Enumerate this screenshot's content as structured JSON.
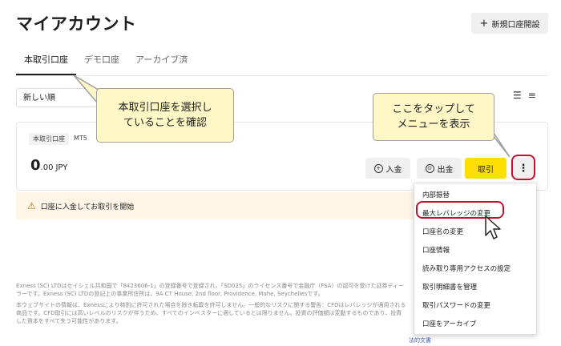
{
  "header": {
    "title": "マイアカウント",
    "new_account_label": "新規口座開設"
  },
  "tabs": [
    {
      "label": "本取引口座",
      "active": true
    },
    {
      "label": "デモ口座",
      "active": false
    },
    {
      "label": "アーカイブ済",
      "active": false
    }
  ],
  "sort": {
    "value": "新しい順"
  },
  "account": {
    "type_badge": "本取引口座",
    "platform_badge": "MT5",
    "balance_int": "0",
    "balance_dec": ".00",
    "currency": "JPY",
    "deposit_label": "入金",
    "withdraw_label": "出金",
    "trade_label": "取引",
    "more_icon": "⋮"
  },
  "notice": {
    "text": "口座に入金してお取引を開始"
  },
  "menu": {
    "items": [
      "内部振替",
      "最大レバレッジの変更",
      "口座名の変更",
      "口座情報",
      "読み取り専用アクセスの設定",
      "取引明細書を管理",
      "取引パスワードの変更",
      "口座をアーカイブ"
    ]
  },
  "footer": {
    "p1": "Exness (SC) LTDはセイシェル共和国で「8423606-1」の登録番号で登録され、「SD025」のライセンス番号で金融庁（FSA）の認可を受けた証券ディーラーです。Exness (SC) LTDの登記上の事業所住所は、9A CT House, 2nd floor, Providence, Mahe, Seychellesです。",
    "p2": "本ウェブサイトの情報は、Exnessにより特別に許可された場合を除き転載を許可しません。一般的なリスクに関する警告：CFDはレバレッジが適用される商品です。CFD取引には高いレベルのリスクが伴うため、すべてのインベスターに適しているとは限りません。投資の評価額は変動するものであり、投資した資本をすべて失う可能性があります。",
    "link_last": "法的文書"
  },
  "annotations": {
    "callout_left": "本取引口座を選択し\nていることを確認",
    "callout_right": "ここをタップして\nメニューを表示"
  },
  "colors": {
    "accent_yellow": "#ffde02",
    "highlight_red": "#c8102e",
    "callout_bg": "#fff8c6"
  }
}
